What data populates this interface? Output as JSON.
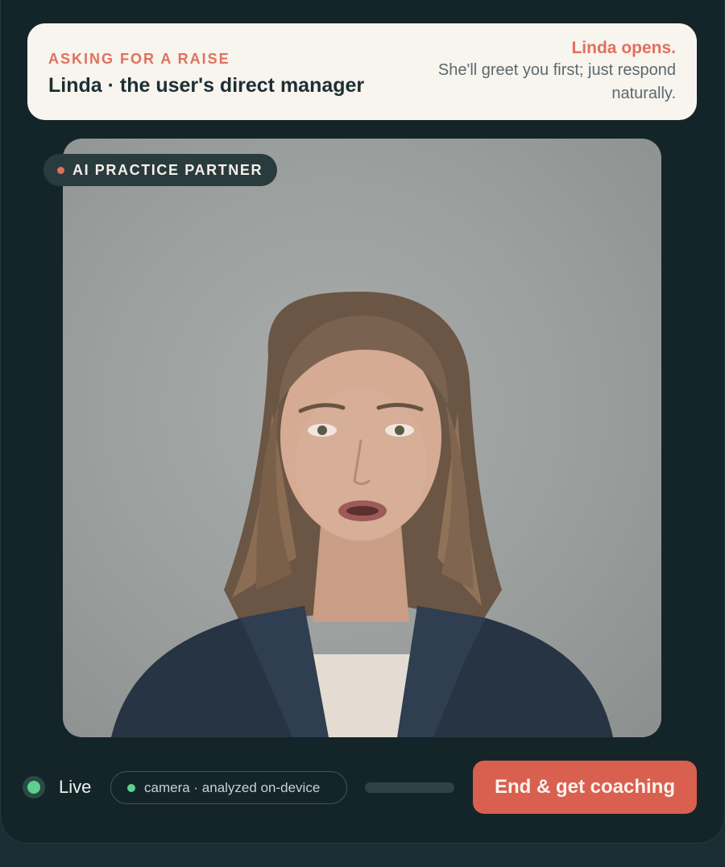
{
  "scenario": {
    "eyebrow": "ASKING FOR A RAISE",
    "title": "Linda · the user's direct manager",
    "turn_hint_strong": "Linda opens.",
    "turn_hint_body": "She'll greet you first; just respond naturally."
  },
  "video": {
    "badge_label": "AI PRACTICE PARTNER",
    "subject": "Woman with shoulder-length brown hair in a navy blazer speaking to camera"
  },
  "status": {
    "live_label": "Live",
    "camera_label": "camera · analyzed on-device",
    "audio_level": 0.0
  },
  "actions": {
    "end_label": "End & get coaching"
  },
  "colors": {
    "accent": "#e0705e",
    "button": "#d9604f",
    "live": "#5fd08d",
    "background": "#142529",
    "card": "#f8f4ee"
  }
}
